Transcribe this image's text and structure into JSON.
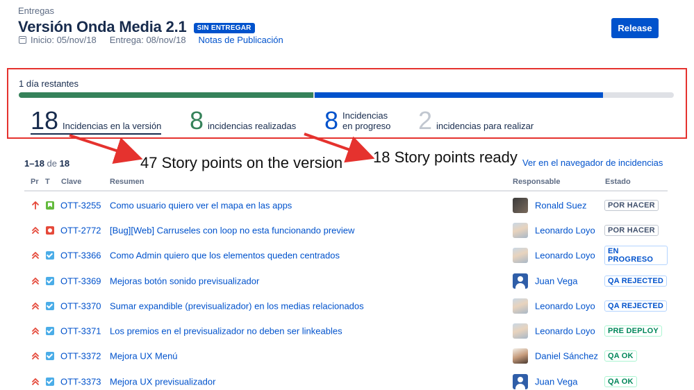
{
  "breadcrumb": "Entregas",
  "version": {
    "title": "Versión Onda Media 2.1",
    "status": "SIN ENTREGAR",
    "start": "Inicio: 05/nov/18",
    "release_date": "Entrega: 08/nov/18",
    "release_notes": "Notas de Publicación",
    "release_button": "Release"
  },
  "progress": {
    "days_left": "1 día restantes",
    "done_fraction": 0.45,
    "in_progress_fraction": 0.44,
    "colors": {
      "done": "#36825a",
      "in_progress": "#0052cc",
      "todo": "#dfe1e6"
    },
    "stats": {
      "total": {
        "num": "18",
        "label": "Incidencias en la versión"
      },
      "done": {
        "num": "8",
        "label": "incidencias realizadas"
      },
      "in_progress": {
        "num": "8",
        "label_line1": "Incidencias",
        "label_line2": "en progreso"
      },
      "todo": {
        "num": "2",
        "label": "incidencias para realizar"
      }
    }
  },
  "annotations": {
    "story_points_version": "47 Story points on the version",
    "story_points_ready": "18 Story points ready"
  },
  "list": {
    "range": "1–18",
    "of": "de",
    "total": "18",
    "view_in_navigator": "Ver en el navegador de incidencias",
    "headers": {
      "priority": "Pr",
      "type": "T",
      "key": "Clave",
      "summary": "Resumen",
      "assignee": "Responsable",
      "status": "Estado"
    },
    "rows": [
      {
        "priority": "high-priority-icon",
        "type": "story",
        "key": "OTT-3255",
        "summary": "Como usuario quiero ver el mapa en las apps",
        "avatar": "photo1",
        "assignee": "Ronald Suez",
        "status": "POR HACER",
        "status_style": "gray"
      },
      {
        "priority": "highest-priority-icon",
        "type": "bug",
        "key": "OTT-2772",
        "summary": "[Bug][Web] Carruseles con loop no esta funcionando preview",
        "avatar": "photo2",
        "assignee": "Leonardo Loyo",
        "status": "POR HACER",
        "status_style": "gray"
      },
      {
        "priority": "highest-priority-icon",
        "type": "task",
        "key": "OTT-3366",
        "summary": "Como Admin quiero que los elementos queden centrados",
        "avatar": "photo2",
        "assignee": "Leonardo Loyo",
        "status": "EN PROGRESO",
        "status_style": "blue"
      },
      {
        "priority": "highest-priority-icon",
        "type": "task",
        "key": "OTT-3369",
        "summary": "Mejoras botón sonido previsualizador",
        "avatar": "blue",
        "assignee": "Juan Vega",
        "status": "QA REJECTED",
        "status_style": "blue"
      },
      {
        "priority": "highest-priority-icon",
        "type": "task",
        "key": "OTT-3370",
        "summary": "Sumar expandible (previsualizador) en los medias relacionados",
        "avatar": "photo2",
        "assignee": "Leonardo Loyo",
        "status": "QA REJECTED",
        "status_style": "blue"
      },
      {
        "priority": "highest-priority-icon",
        "type": "task",
        "key": "OTT-3371",
        "summary": "Los premios en el previsualizador no deben ser linkeables",
        "avatar": "photo2",
        "assignee": "Leonardo Loyo",
        "status": "PRE DEPLOY",
        "status_style": "green"
      },
      {
        "priority": "highest-priority-icon",
        "type": "task",
        "key": "OTT-3372",
        "summary": "Mejora UX Menú",
        "avatar": "photo3",
        "assignee": "Daniel Sánchez",
        "status": "QA OK",
        "status_style": "green"
      },
      {
        "priority": "highest-priority-icon",
        "type": "task",
        "key": "OTT-3373",
        "summary": "Mejora UX previsualizador",
        "avatar": "blue",
        "assignee": "Juan Vega",
        "status": "QA OK",
        "status_style": "green"
      }
    ]
  }
}
